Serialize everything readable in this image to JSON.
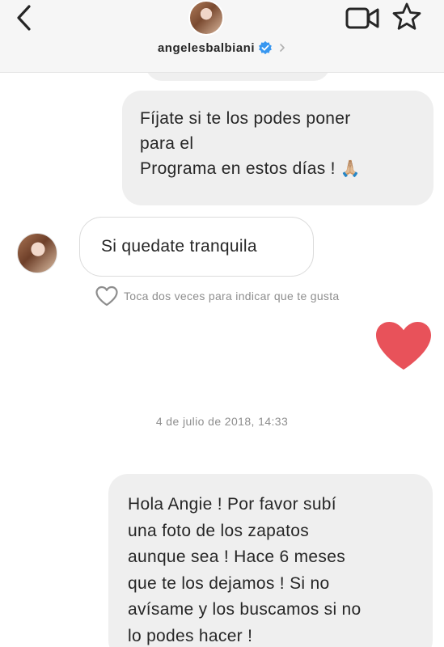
{
  "header": {
    "username": "angelesbalbiani",
    "verified": true,
    "icons": {
      "back": "chevron-left-icon",
      "video": "video-camera-icon",
      "star": "star-icon",
      "verified": "verified-badge-icon",
      "chevron": "chevron-right-icon"
    }
  },
  "messages": [
    {
      "direction": "outgoing",
      "lines": [
        "Fíjate si te los podes poner",
        "para el",
        "Programa en estos días !"
      ],
      "emoji": "🙏🏼"
    },
    {
      "direction": "incoming",
      "lines": [
        "Si quedate tranquila"
      ]
    },
    {
      "direction": "outgoing",
      "type": "heart",
      "icon": "heart-icon",
      "color": "#e8525a"
    },
    {
      "direction": "outgoing",
      "lines": [
        "Hola Angie ! Por favor subí",
        "una foto de los zapatos",
        "aunque sea ! Hace 6 meses",
        "que te los dejamos ! Si no",
        "avísame y los buscamos si no",
        "lo podes hacer !"
      ]
    }
  ],
  "like_hint": "Toca dos veces para indicar que te gusta",
  "timestamp": "4 de julio de 2018, 14:33",
  "colors": {
    "header_bg": "#f6f6f6",
    "bubble_out": "#efefef",
    "bubble_in_border": "#dbdbdb",
    "verified_blue": "#3897f0",
    "heart_red": "#e8525a",
    "meta_gray": "#8e8e8e"
  }
}
